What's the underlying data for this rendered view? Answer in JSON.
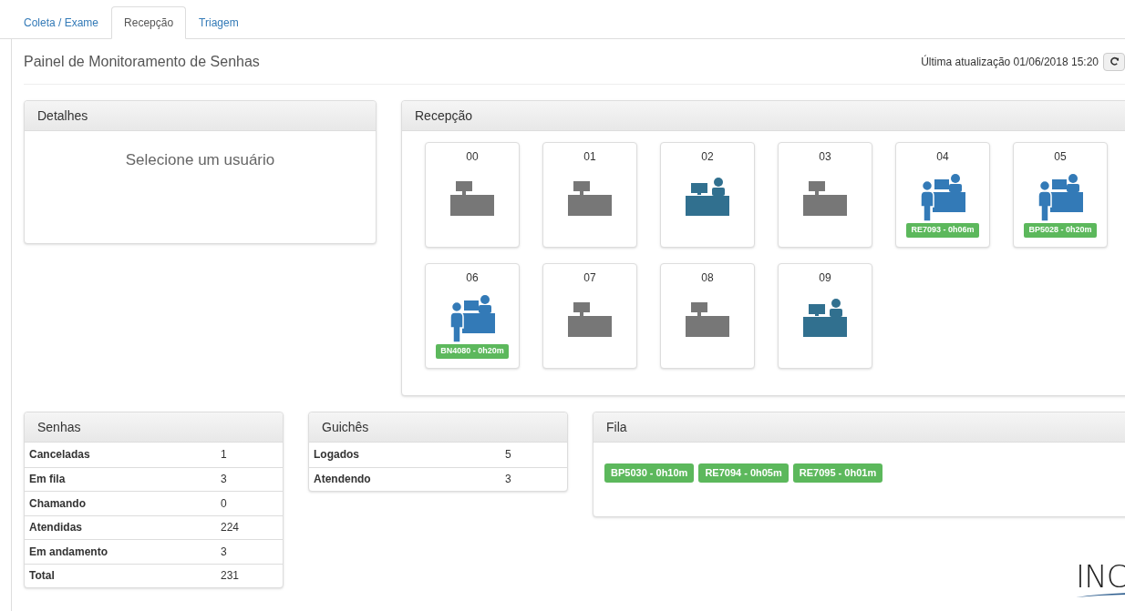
{
  "tabs": [
    {
      "label": "Coleta / Exame",
      "selected": false
    },
    {
      "label": "Recepção",
      "selected": true
    },
    {
      "label": "Triagem",
      "selected": false
    }
  ],
  "page_title": "Painel de Monitoramento de Senhas",
  "last_update": "Última atualização 01/06/2018 15:20",
  "details": {
    "title": "Detalhes",
    "message": "Selecione um usuário"
  },
  "reception": {
    "title": "Recepção",
    "counters": [
      {
        "number": "00",
        "kind": "idle"
      },
      {
        "number": "01",
        "kind": "idle"
      },
      {
        "number": "02",
        "kind": "logged"
      },
      {
        "number": "03",
        "kind": "idle"
      },
      {
        "number": "04",
        "kind": "serving",
        "ticket": "RE7093 - 0h06m"
      },
      {
        "number": "05",
        "kind": "serving",
        "ticket": "BP5028 - 0h20m"
      },
      {
        "number": "06",
        "kind": "serving",
        "ticket": "BN4080 - 0h20m"
      },
      {
        "number": "07",
        "kind": "idle"
      },
      {
        "number": "08",
        "kind": "idle"
      },
      {
        "number": "09",
        "kind": "logged"
      }
    ]
  },
  "passwords": {
    "title": "Senhas",
    "rows": [
      {
        "label": "Canceladas",
        "value": "1"
      },
      {
        "label": "Em fila",
        "value": "3"
      },
      {
        "label": "Chamando",
        "value": "0"
      },
      {
        "label": "Atendidas",
        "value": "224"
      },
      {
        "label": "Em andamento",
        "value": "3"
      },
      {
        "label": "Total",
        "value": "231"
      }
    ]
  },
  "counters_summary": {
    "title": "Guichês",
    "rows": [
      {
        "label": "Logados",
        "value": "5"
      },
      {
        "label": "Atendendo",
        "value": "3"
      }
    ]
  },
  "queue": {
    "title": "Fila",
    "tickets": [
      "BP5030 - 0h10m",
      "RE7094 - 0h05m",
      "RE7095 - 0h01m"
    ]
  },
  "logo": {
    "text": "INC"
  }
}
